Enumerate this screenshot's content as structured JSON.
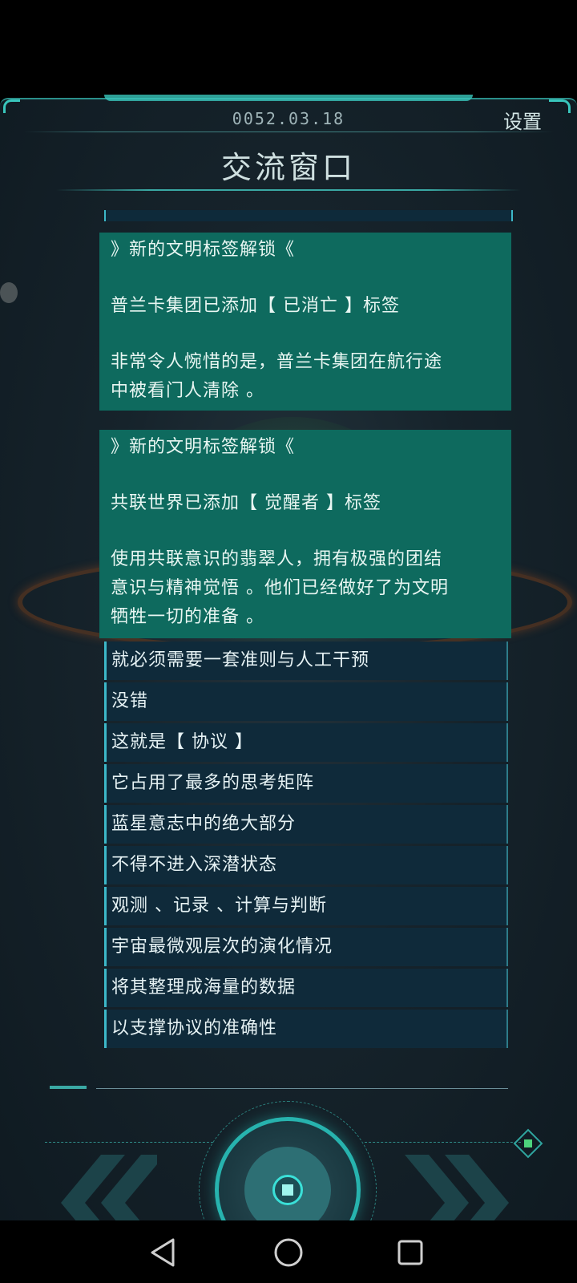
{
  "header": {
    "date": "0052.03.18",
    "settings_label": "设置",
    "title": "交流窗口"
  },
  "cards": [
    {
      "heading": "》新的文明标签解锁《",
      "line1": "普兰卡集团已添加【 已消亡 】标签",
      "line2": "非常令人惋惜的是，普兰卡集团在航行途",
      "line3": "中被看门人清除 。"
    },
    {
      "heading": "》新的文明标签解锁《",
      "line1": "共联世界已添加【 觉醒者 】标签",
      "line2": "使用共联意识的翡翠人，拥有极强的团结",
      "line3": "意识与精神觉悟 。他们已经做好了为文明",
      "line4": "牺牲一切的准备 。"
    }
  ],
  "messages": [
    "就必须需要一套准则与人工干预",
    "没错",
    "这就是【 协议 】",
    "它占用了最多的思考矩阵",
    "蓝星意志中的绝大部分",
    "不得不进入深潜状态",
    "观测 、记录 、计算与判断",
    "宇宙最微观层次的演化情况",
    "将其整理成海量的数据",
    "以支撑协议的准确性"
  ],
  "colors": {
    "accent": "#39c6bc",
    "card_bg": "#0e6a5e",
    "row_bg": "#0f2a3a"
  },
  "icons": {
    "prev": "double-chevron-left-icon",
    "next": "double-chevron-right-icon",
    "center": "center-action-icon",
    "nav_back": "triangle-back-icon",
    "nav_home": "circle-home-icon",
    "nav_recent": "square-recent-icon"
  }
}
